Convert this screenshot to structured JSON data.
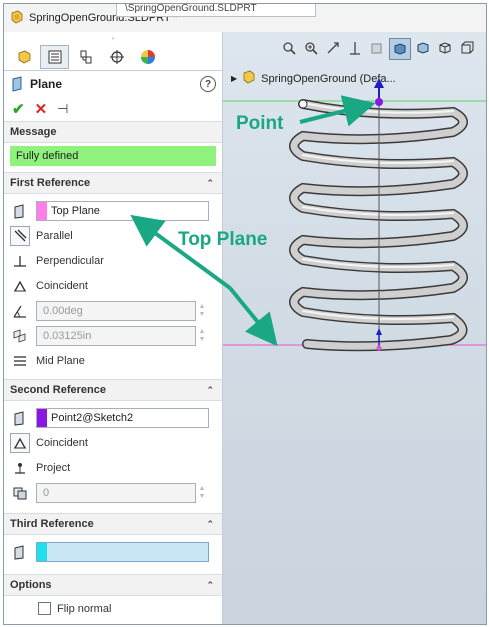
{
  "window": {
    "doc_title": "SpringOpenGround.SLDPRT *",
    "path_tab": "\\SpringOpenGround.SLDPRT"
  },
  "panel": {
    "title": "Plane",
    "help": "?",
    "sections": {
      "message": "Message",
      "first": "First Reference",
      "second": "Second Reference",
      "third": "Third Reference",
      "options": "Options"
    },
    "message_text": "Fully defined",
    "first_ref": {
      "entity": "Top Plane",
      "swatch": "#ff7ee8",
      "options": [
        "Parallel",
        "Perpendicular",
        "Coincident"
      ],
      "angle": "0.00deg",
      "distance": "0.03125in",
      "mid_plane": "Mid Plane"
    },
    "second_ref": {
      "entity": "Point2@Sketch2",
      "swatch": "#8a16e6",
      "options": [
        "Coincident",
        "Project"
      ],
      "count": "0"
    },
    "third_ref": {
      "swatch": "#22e0f0"
    },
    "options": {
      "flip_normal": "Flip normal"
    }
  },
  "viewport": {
    "tree_item": "SpringOpenGround  (Defa..."
  },
  "annotations": {
    "point": "Point",
    "top_plane": "Top Plane",
    "arrow_color": "#1aa884"
  }
}
